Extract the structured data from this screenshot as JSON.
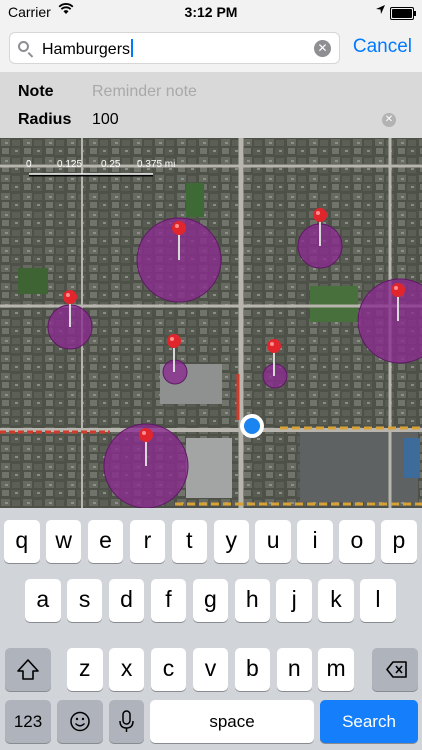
{
  "status_bar": {
    "carrier": "Carrier",
    "time": "3:12 PM",
    "battery_level": 1.0
  },
  "search": {
    "value": "Hamburgers",
    "cancel_label": "Cancel"
  },
  "form": {
    "note_label": "Note",
    "note_placeholder": "Reminder note",
    "radius_label": "Radius",
    "radius_value": "100"
  },
  "map": {
    "scale_labels": [
      "0",
      "0.125",
      "0.25",
      "0.375 mi"
    ],
    "geofence_color": "#8a2a8f",
    "pin_color": "#e0262c",
    "user_location_color": "#1a84f0"
  },
  "keyboard": {
    "row1": [
      "q",
      "w",
      "e",
      "r",
      "t",
      "y",
      "u",
      "i",
      "o",
      "p"
    ],
    "row2": [
      "a",
      "s",
      "d",
      "f",
      "g",
      "h",
      "j",
      "k",
      "l"
    ],
    "row3": [
      "z",
      "x",
      "c",
      "v",
      "b",
      "n",
      "m"
    ],
    "numbers_label": "123",
    "space_label": "space",
    "search_label": "Search"
  }
}
